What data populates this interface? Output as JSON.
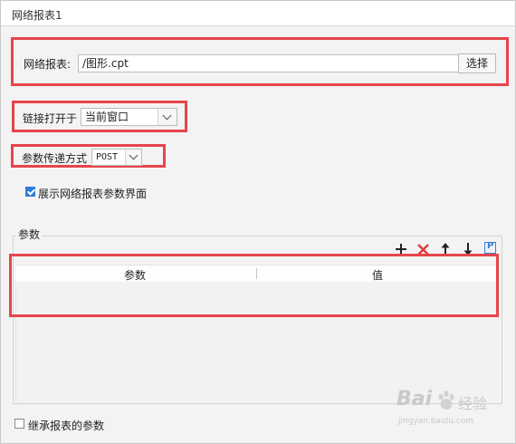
{
  "window": {
    "title": "网络报表1"
  },
  "report": {
    "label": "网络报表:",
    "value": "/图形.cpt",
    "select_button": "选择"
  },
  "link_open": {
    "label": "链接打开于",
    "selected": "当前窗口"
  },
  "param_method": {
    "label": "参数传递方式",
    "selected": "POST"
  },
  "show_params": {
    "label": "展示网络报表参数界面",
    "checked": true
  },
  "params_group": {
    "title": "参数",
    "toolbar": [
      "add-icon",
      "delete-icon",
      "move-up-icon",
      "move-down-icon",
      "parameter-icon"
    ],
    "parameter_icon_letter": "P",
    "table": {
      "columns": [
        "参数",
        "值"
      ],
      "rows": []
    }
  },
  "inherit_params": {
    "label": "继承报表的参数",
    "checked": false
  },
  "watermark": {
    "brand": "Bai",
    "sub": "经验",
    "url": "jingyan.baidu.com"
  },
  "colors": {
    "highlight": "#e8454b",
    "check_blue": "#2f7bd8",
    "delete_red": "#e23a3a",
    "param_blue": "#3b7fd6"
  }
}
